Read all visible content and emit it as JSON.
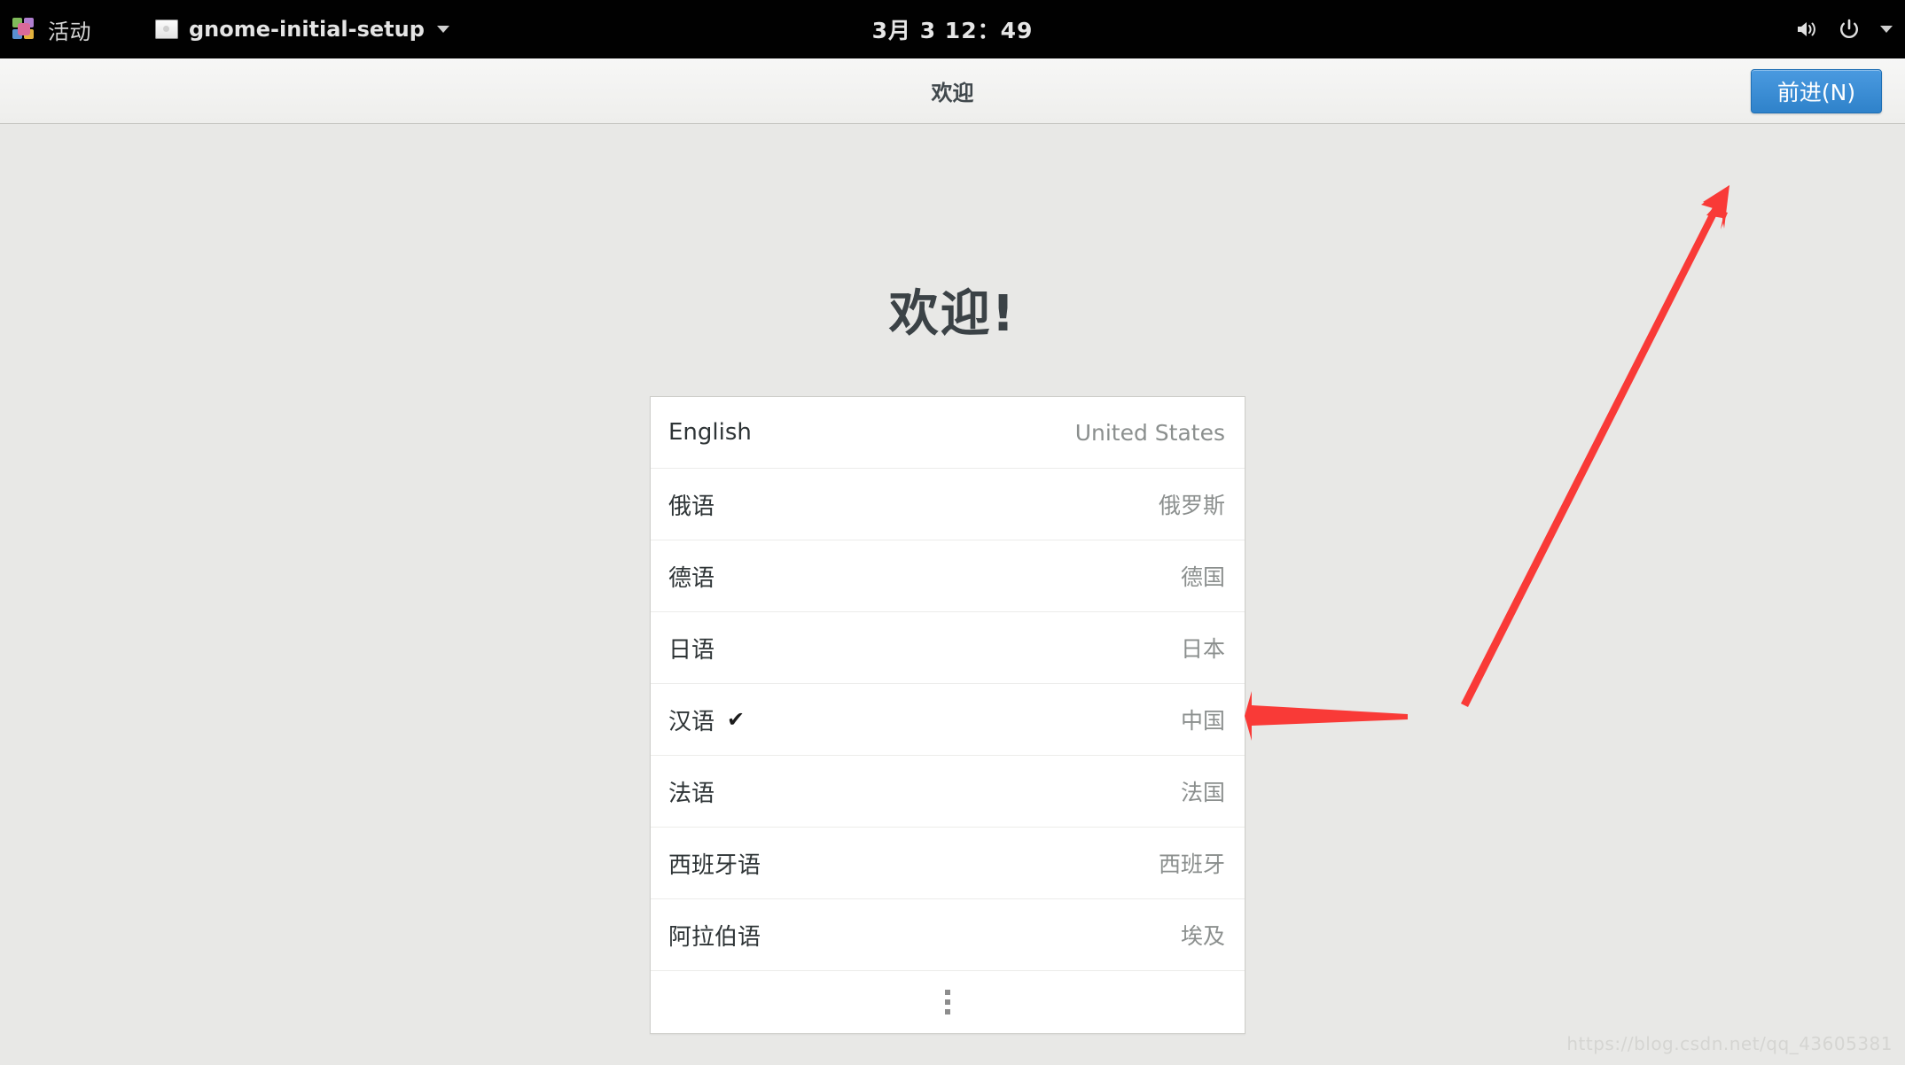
{
  "topbar": {
    "activities_label": "活动",
    "distro_icon": "distro-logo-icon",
    "app_icon": "window-app-icon",
    "app_name": "gnome-initial-setup",
    "app_menu_caret": "chevron-down-icon",
    "clock": "3月 3  12：49",
    "volume_icon": "volume-icon",
    "power_icon": "power-icon",
    "system_menu_caret": "chevron-down-icon"
  },
  "headerbar": {
    "title": "欢迎",
    "next_label": "前进(N)"
  },
  "main": {
    "welcome_title": "欢迎!",
    "language_list": {
      "rows": [
        {
          "name": "English",
          "region": "United States",
          "selected": false
        },
        {
          "name": "俄语",
          "region": "俄罗斯",
          "selected": false
        },
        {
          "name": "德语",
          "region": "德国",
          "selected": false
        },
        {
          "name": "日语",
          "region": "日本",
          "selected": false
        },
        {
          "name": "汉语",
          "region": "中国",
          "selected": true,
          "check": "✔"
        },
        {
          "name": "法语",
          "region": "法国",
          "selected": false
        },
        {
          "name": "西班牙语",
          "region": "西班牙",
          "selected": false
        },
        {
          "name": "阿拉伯语",
          "region": "埃及",
          "selected": false
        }
      ],
      "more_button": "more-options-icon"
    }
  },
  "annotations": {
    "arrow_color": "#f93a37",
    "arrow_to_selected_row": "arrow pointing left at 汉语 / 中国 row",
    "arrow_to_next_button": "arrow pointing up-right at 前进(N) button"
  },
  "watermark": {
    "text": "https://blog.csdn.net/qq_43605381"
  },
  "colors": {
    "topbar_bg": "#010101",
    "header_bg": "#eeeeec",
    "content_bg": "#e8e8e6",
    "accent_blue": "#3584c6",
    "list_bg": "#ffffff",
    "muted_text": "#8b8f8e"
  }
}
